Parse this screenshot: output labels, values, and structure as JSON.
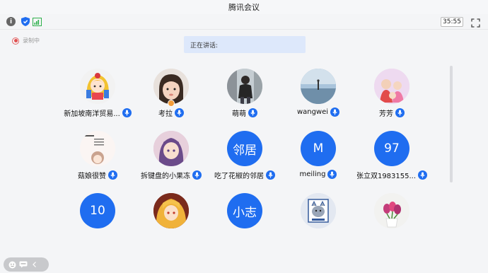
{
  "window": {
    "title": "腾讯会议"
  },
  "toolbar": {
    "timer": "35:55",
    "info_glyph": "i"
  },
  "recording": {
    "label": "录制中"
  },
  "speaking": {
    "label": "正在讲话:"
  },
  "participants": [
    {
      "name": "新加坡南洋贸易...",
      "avatar": "photo",
      "mic": true
    },
    {
      "name": "考拉",
      "avatar": "photo",
      "mic": true,
      "host": true
    },
    {
      "name": "萌萌",
      "avatar": "photo",
      "mic": true
    },
    {
      "name": "wangwei",
      "avatar": "photo",
      "mic": true
    },
    {
      "name": "芳芳",
      "avatar": "photo",
      "mic": true
    },
    {
      "name": "菇娘很赞",
      "avatar": "photo",
      "mic": true
    },
    {
      "name": "拆键盘的小果冻",
      "avatar": "photo",
      "mic": true
    },
    {
      "name": "吃了花椒的邻居",
      "avatar_text": "邻居",
      "mic": true
    },
    {
      "name": "meiling",
      "avatar_text": "M",
      "mic": true
    },
    {
      "name": "张立双1983155...",
      "avatar_text": "97",
      "mic": true
    },
    {
      "avatar_text": "10"
    },
    {
      "avatar": "photo"
    },
    {
      "avatar_text": "小志"
    },
    {
      "avatar": "photo"
    },
    {
      "avatar": "photo"
    }
  ],
  "colors": {
    "accent": "#1f6df0",
    "speaking_bg": "#dde8fb",
    "record": "#e05050"
  }
}
